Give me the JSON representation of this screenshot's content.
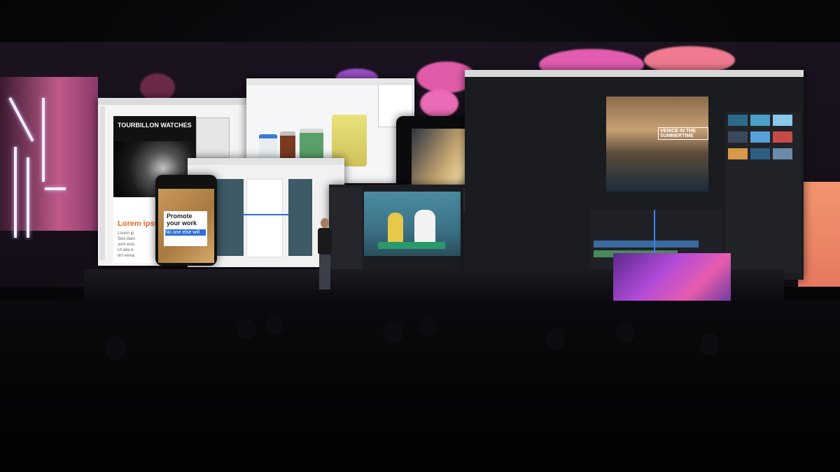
{
  "scene": {
    "description_label": "",
    "colors": {
      "pink_accent": "#e75aa8",
      "magenta": "#d14ea0",
      "purple": "#6a4cc8",
      "stage_dark": "#050507"
    }
  },
  "brochure": {
    "headline": "TOURBILLON WATCHES",
    "lorem_heading": "Lorem ipsu",
    "body_lines": [
      "Lorem ip",
      "Sed diam",
      "sum euis",
      "Ut wisi e",
      "tim venia"
    ]
  },
  "phone_card": {
    "line1": "Promote",
    "line2": "your work",
    "highlight": "No one else will"
  },
  "video_overlay": {
    "title_line1": "VENICE IN THE",
    "title_line2": "SUMMERTIME"
  },
  "icons": {
    "neon_logo": "y-shape-neon",
    "playhead": "playhead-icon"
  }
}
